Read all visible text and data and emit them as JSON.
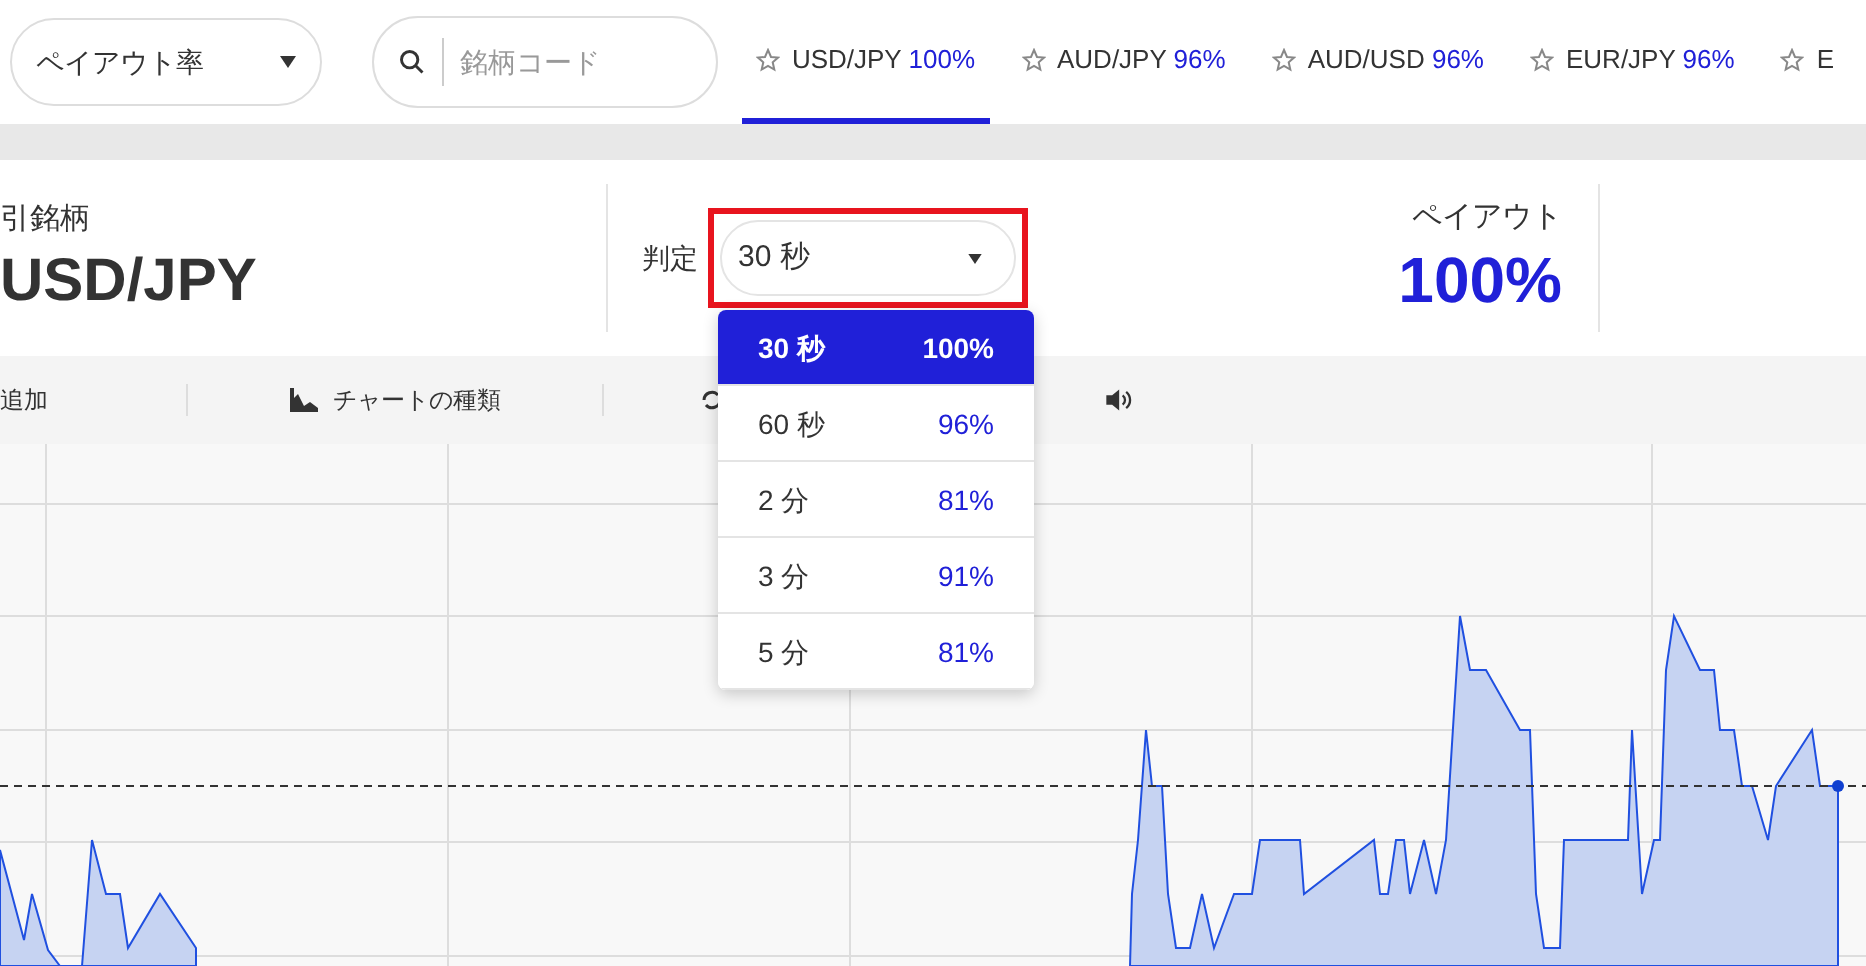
{
  "payout_filter": {
    "value": "ペイアウト率"
  },
  "search": {
    "placeholder": "銘柄コード"
  },
  "tabs": [
    {
      "pair": "USD/JPY",
      "payout": "100%",
      "selected": true
    },
    {
      "pair": "AUD/JPY",
      "payout": "96%",
      "selected": false
    },
    {
      "pair": "AUD/USD",
      "payout": "96%",
      "selected": false
    },
    {
      "pair": "EUR/JPY",
      "payout": "96%",
      "selected": false
    },
    {
      "pair": "E",
      "selected": false
    }
  ],
  "instrument": {
    "label": "引銘柄",
    "value": "USD/JPY"
  },
  "expiry": {
    "label": "判定",
    "value": "30 秒",
    "highlighted": true
  },
  "payout": {
    "label": "ペイアウト",
    "value": "100%"
  },
  "toolbar": [
    {
      "kind": "text",
      "label": "追加"
    },
    {
      "kind": "chart_type",
      "label": "チャートの種類"
    },
    {
      "kind": "refresh"
    },
    {
      "kind": "sound"
    }
  ],
  "expiry_options": [
    {
      "time": "30 秒",
      "payout": "100%",
      "selected": true
    },
    {
      "time": "60 秒",
      "payout": "96%",
      "selected": false
    },
    {
      "time": "2 分",
      "payout": "81%",
      "selected": false
    },
    {
      "time": "3 分",
      "payout": "91%",
      "selected": false
    },
    {
      "time": "5 分",
      "payout": "81%",
      "selected": false
    }
  ]
}
